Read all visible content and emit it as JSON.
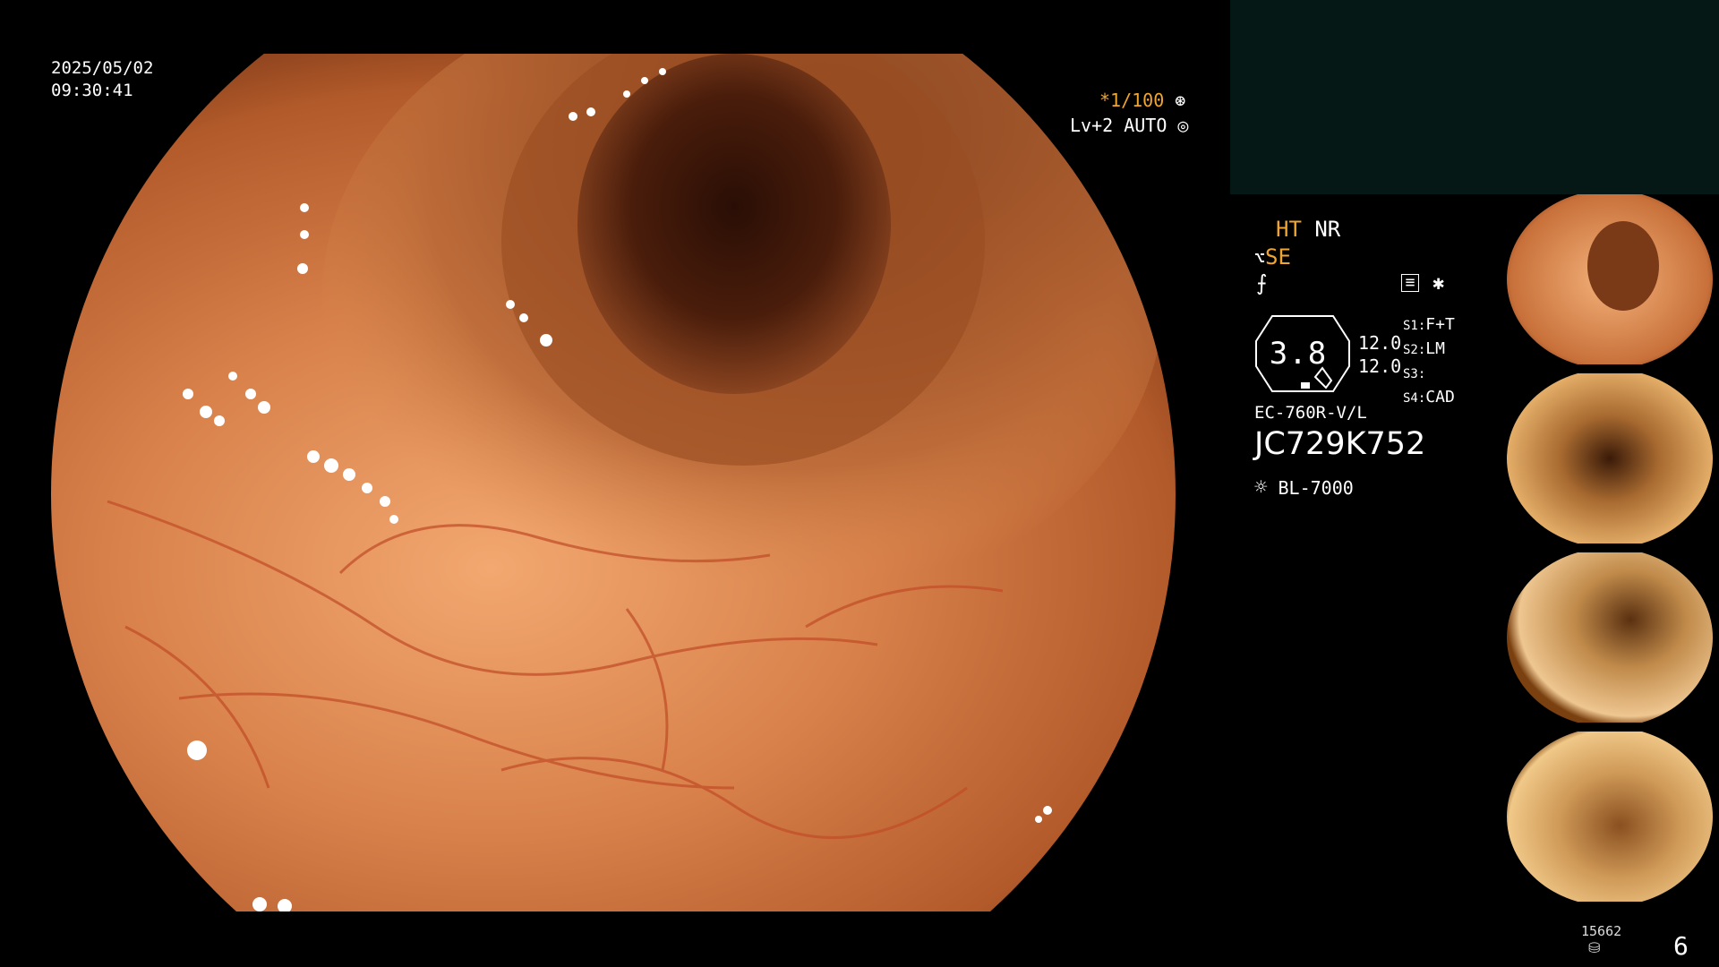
{
  "overlay": {
    "date": "2025/05/02",
    "time": "09:30:41",
    "shutter": "*1/100",
    "level": "Lv+2 AUTO"
  },
  "info": {
    "ht": "HT",
    "nr": "NR",
    "se": "SE",
    "gauge_value": "3.8",
    "scale_top": "12.0",
    "scale_bottom": "12.0",
    "switches": [
      {
        "label": "S1:",
        "value": "F+T"
      },
      {
        "label": "S2:",
        "value": "LM"
      },
      {
        "label": "S3:",
        "value": ""
      },
      {
        "label": "S4:",
        "value": "CAD"
      }
    ],
    "scope_model": "EC-760R-V/L",
    "serial": "JC729K752",
    "light_source": "BL-7000"
  },
  "footer": {
    "count": "15662",
    "page": "6"
  },
  "colors": {
    "orange_text": "#f0a530",
    "panel_dark": "#061816"
  },
  "icons": [
    "shutter-icon",
    "auto-iris-icon",
    "se-icon",
    "f-icon",
    "record-icon",
    "asterisk-icon",
    "lamp-icon",
    "disk-icon"
  ]
}
